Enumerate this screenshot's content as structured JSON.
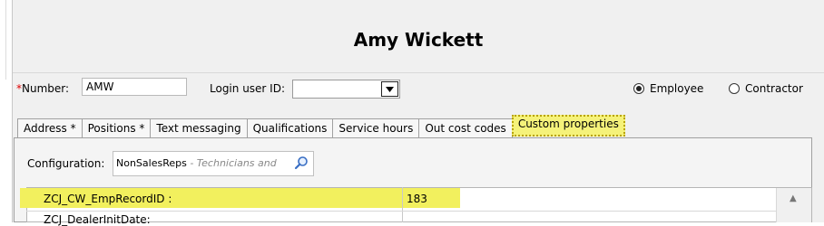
{
  "header": {
    "title": "Amy Wickett"
  },
  "form": {
    "number_required_marker": "*",
    "number_label": "Number:",
    "number_value": "AMW",
    "login_label": "Login user ID:",
    "login_value": "",
    "employee_label": "Employee",
    "contractor_label": "Contractor",
    "selected_type": "Employee"
  },
  "tabs": [
    {
      "label": "Address *"
    },
    {
      "label": "Positions *"
    },
    {
      "label": "Text messaging"
    },
    {
      "label": "Qualifications"
    },
    {
      "label": "Service hours"
    },
    {
      "label": "Out cost codes"
    },
    {
      "label": "Custom properties",
      "active": true
    }
  ],
  "custom_properties": {
    "configuration_label": "Configuration:",
    "configuration_value": "NonSalesReps",
    "configuration_hint": " - Technicians and",
    "rows": [
      {
        "name": "ZCJ_CW_EmpRecordID :",
        "value": "183"
      },
      {
        "name": "ZCJ_DealerInitDate:",
        "value": ""
      }
    ]
  },
  "icons": {
    "search": "search-icon",
    "dropdown": "chevron-down-icon",
    "scroll_up": "scroll-up-icon"
  },
  "colors": {
    "highlight": "#f2f05e",
    "required": "#e00000"
  }
}
